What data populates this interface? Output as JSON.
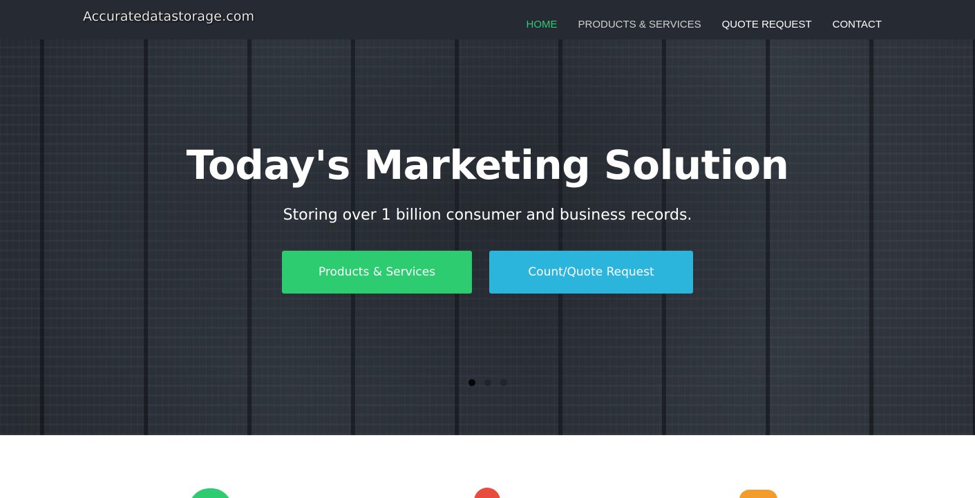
{
  "header": {
    "logo": "Accuratedatastorage.com",
    "nav": [
      {
        "label": "HOME",
        "active": true
      },
      {
        "label": "PRODUCTS & SERVICES",
        "active": false
      },
      {
        "label": "QUOTE REQUEST",
        "active": false
      },
      {
        "label": "CONTACT",
        "active": false
      }
    ]
  },
  "hero": {
    "title": "Today's Marketing Solution",
    "subtitle": "Storing over 1 billion consumer and business records.",
    "primary_button": "Products & Services",
    "secondary_button": "Count/Quote Request",
    "slides": 3,
    "active_slide": 1
  },
  "features": {
    "icons": [
      "database-icon",
      "location-pin-icon",
      "chat-icon"
    ]
  },
  "colors": {
    "accent_green": "#2ecc71",
    "accent_blue": "#2bb5dc",
    "header_bg": "#262b33"
  }
}
